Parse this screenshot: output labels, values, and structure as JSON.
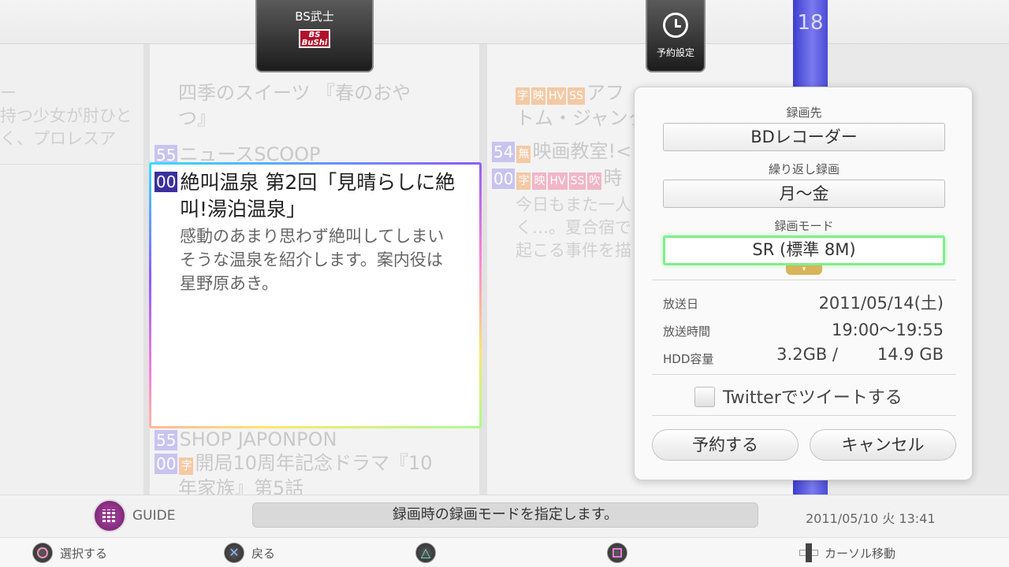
{
  "channel": {
    "name": "BS武士",
    "logo_text": "BuShi",
    "logo_top": "BS"
  },
  "reservation_tab": {
    "label": "予約設定",
    "icon": "clock-icon"
  },
  "time_slot": "18",
  "programs": {
    "left_col": [
      "ー",
      "持つ少女が肘ひと",
      "く、プロレスア"
    ],
    "mid_above_1": "四季のスイーツ 『春のおや",
    "mid_above_2": "つ』",
    "mid_above_3_num": "55",
    "mid_above_3": "ニュースSCOOP",
    "right_1_tags": [
      "字",
      "映",
      "HV",
      "SS"
    ],
    "right_1": "アフ",
    "right_2": "トム・ジャンク",
    "right_3_num": "54",
    "right_3_tag": "無",
    "right_3": "映画教室!<",
    "right_4_num": "00",
    "right_4_tags": [
      "字",
      "映",
      "HV",
      "SS",
      "吹"
    ],
    "right_4": "時",
    "right_5": "今日もまた一人",
    "right_6": "く…。夏合宿で",
    "right_7": "起こる事件を描",
    "mid_below_1_num": "55",
    "mid_below_1": "SHOP JAPONPON",
    "mid_below_2_num": "00",
    "mid_below_2_tag": "字",
    "mid_below_2": "開局10周年記念ドラマ『10",
    "mid_below_3": "年家族』第5話"
  },
  "selected": {
    "time": "00",
    "title_line1": "絶叫温泉 第2回「見晴らしに絶",
    "title_line2": "叫!湯泊温泉」",
    "desc_line1": "感動のあまり思わず絶叫してしまい",
    "desc_line2": "そうな温泉を紹介します。案内役は",
    "desc_line3": "星野原あき。"
  },
  "dialog": {
    "dest_label": "録画先",
    "dest_value": "BDレコーダー",
    "repeat_label": "繰り返し録画",
    "repeat_value": "月～金",
    "mode_label": "録画モード",
    "mode_value": "SR (標準 8M)",
    "broadcast_date_label": "放送日",
    "broadcast_date_value": "2011/05/14(土)",
    "broadcast_time_label": "放送時間",
    "broadcast_time_value": "19:00～19:55",
    "hdd_label": "HDD容量",
    "hdd_used": "3.2GB /",
    "hdd_total": "14.9 GB",
    "twitter_label": "Twitterでツイートする",
    "twitter_checked": false,
    "reserve_button": "予約する",
    "cancel_button": "キャンセル"
  },
  "footer": {
    "guide_label": "GUIDE",
    "status_message": "録画時の録画モードを指定します。",
    "datetime": "2011/05/10 火 13:41",
    "circle_label": "選択する",
    "cross_label": "戻る",
    "cursor_label": "カーソル移動"
  },
  "colors": {
    "timebar": "#5252e0",
    "selection_badge": "#3b2f9e",
    "active_field_border": "#7ef08a",
    "guide_icon": "#8a2a84"
  }
}
